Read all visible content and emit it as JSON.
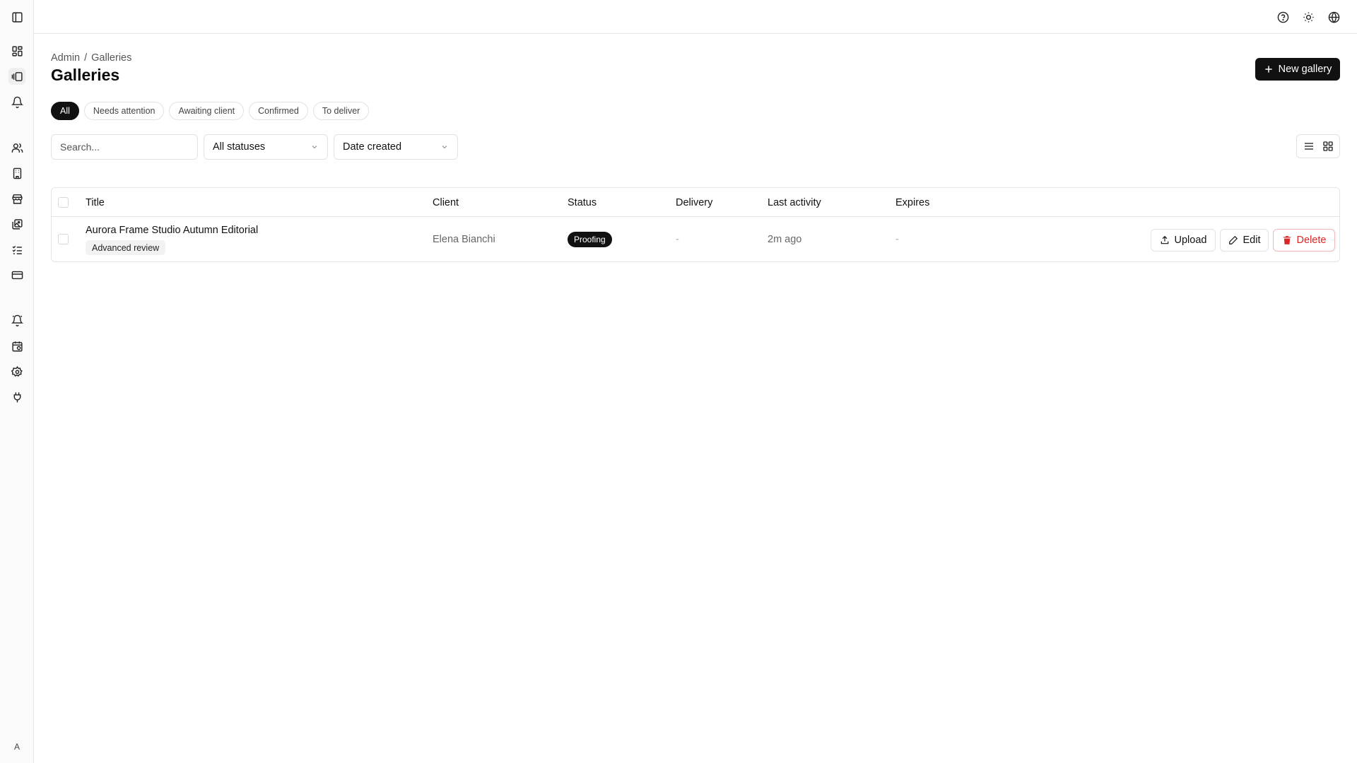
{
  "sidebar": {
    "items": [
      {
        "name": "dashboard",
        "icon": "layout-grid-icon"
      },
      {
        "name": "galleries",
        "icon": "gallery-icon",
        "active": true
      },
      {
        "name": "notifications",
        "icon": "bell-icon"
      },
      {
        "name": "clients",
        "icon": "users-icon"
      },
      {
        "name": "studios",
        "icon": "building-icon"
      },
      {
        "name": "store",
        "icon": "store-icon"
      },
      {
        "name": "photos",
        "icon": "images-icon"
      },
      {
        "name": "tasks",
        "icon": "list-checks-icon"
      },
      {
        "name": "billing",
        "icon": "credit-card-icon"
      },
      {
        "name": "alerts",
        "icon": "bell-ring-icon"
      },
      {
        "name": "schedule",
        "icon": "calendar-clock-icon"
      },
      {
        "name": "settings",
        "icon": "gear-icon"
      },
      {
        "name": "integrations",
        "icon": "plug-icon"
      }
    ],
    "avatar_initial": "A"
  },
  "header": {
    "icons": [
      "help-icon",
      "sun-icon",
      "globe-icon"
    ]
  },
  "breadcrumb": {
    "root": "Admin",
    "separator": "/",
    "current": "Galleries"
  },
  "page": {
    "title": "Galleries",
    "new_button": "New gallery"
  },
  "filters": [
    {
      "label": "All",
      "active": true
    },
    {
      "label": "Needs attention"
    },
    {
      "label": "Awaiting client"
    },
    {
      "label": "Confirmed"
    },
    {
      "label": "To deliver"
    }
  ],
  "search": {
    "placeholder": "Search..."
  },
  "status_select": {
    "value": "All statuses"
  },
  "sort_select": {
    "value": "Date created"
  },
  "table": {
    "columns": [
      "Title",
      "Client",
      "Status",
      "Delivery",
      "Last activity",
      "Expires"
    ],
    "rows": [
      {
        "title": "Aurora Frame Studio Autumn Editorial",
        "tag": "Advanced review",
        "client": "Elena Bianchi",
        "status": "Proofing",
        "delivery": "-",
        "last_activity": "2m ago",
        "expires": "-",
        "actions": {
          "upload": "Upload",
          "edit": "Edit",
          "delete": "Delete"
        }
      }
    ]
  },
  "colors": {
    "primary": "#111111",
    "danger": "#dc2626",
    "border": "#e5e5e5"
  }
}
